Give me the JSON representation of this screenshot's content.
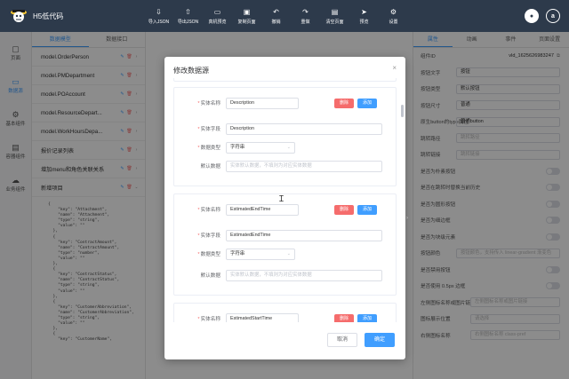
{
  "app": {
    "name": "H5低代码"
  },
  "toolbar": [
    {
      "icon": "⇩",
      "label": "导入JSON"
    },
    {
      "icon": "⇧",
      "label": "导出JSON"
    },
    {
      "icon": "▭",
      "label": "真机预览"
    },
    {
      "icon": "▣",
      "label": "复制页面"
    },
    {
      "icon": "↶",
      "label": "撤销"
    },
    {
      "icon": "↷",
      "label": "重做"
    },
    {
      "icon": "▤",
      "label": "清空页面"
    },
    {
      "icon": "➤",
      "label": "预览"
    },
    {
      "icon": "⚙",
      "label": "设置"
    }
  ],
  "rail": [
    {
      "icon": "▢",
      "label": "页面"
    },
    {
      "icon": "▭",
      "label": "数据源"
    },
    {
      "icon": "⚙",
      "label": "基本组件"
    },
    {
      "icon": "▤",
      "label": "容器组件"
    },
    {
      "icon": "☁",
      "label": "业务组件"
    }
  ],
  "left_panel": {
    "tabs": [
      "数据模型",
      "数据接口"
    ],
    "models": [
      "model.OrderPerson",
      "model.PMDepartment",
      "model.POAccount",
      "model.ResourceDepart...",
      "model.WorkHoursDepa...",
      "报价记录列表",
      "增加menu和角色关联关系",
      "新增项目"
    ],
    "code": "{\n    \"key\": \"Attachment\",\n    \"name\": \"Attachment\",\n    \"type\": \"string\",\n    \"value\": \"\"\n  },\n  {\n    \"key\": \"ContractAmount\",\n    \"name\": \"ContractAmount\",\n    \"type\": \"number\",\n    \"value\": \"\"\n  },\n  {\n    \"key\": \"ContractStatus\",\n    \"name\": \"ContractStatus\",\n    \"type\": \"string\",\n    \"value\": \"\"\n  },\n  {\n    \"key\": \"CustomerAbbreviation\",\n    \"name\": \"CustomerAbbreviation\",\n    \"type\": \"string\",\n    \"value\": \"\"\n  },\n  {\n    \"key\": \"CustomerName\","
  },
  "right_panel": {
    "tabs": [
      "属性",
      "动画",
      "事件",
      "页面设置"
    ],
    "component_id_label": "组件ID",
    "component_id": "vld_1625626983247",
    "rows": [
      {
        "label": "按钮文字",
        "value": "按钮"
      },
      {
        "label": "按钮类型",
        "value": "默认按钮"
      },
      {
        "label": "按钮尺寸",
        "value": "普通"
      },
      {
        "label": "原生button的type属性",
        "value": "普通button"
      },
      {
        "label": "跳转路径",
        "value": "跳转路径",
        "placeholder": true
      },
      {
        "label": "跳转链接",
        "value": "跳转链接",
        "placeholder": true
      }
    ],
    "toggles": [
      "是否为朴素按钮",
      "是否在跳转时替换当前历史",
      "是否为圆形按钮",
      "是否为细边框",
      "是否为块级元素"
    ],
    "color_row": {
      "label": "按钮颜色",
      "placeholder": "按钮颜色，支持传入 linear-gradient 渐变色"
    },
    "toggles2": [
      "是否禁用按钮",
      "是否使用 0.5px 边框"
    ],
    "extra_rows": [
      {
        "label": "左侧图标名称或图片链接",
        "placeholder": "左侧图标名称或图片链接"
      },
      {
        "label": "图标展示位置",
        "placeholder": "请选择"
      },
      {
        "label": "右侧图标名称",
        "placeholder": "右侧图标名称 class-pref"
      }
    ]
  },
  "dialog": {
    "title": "修改数据源",
    "close": "×",
    "labels": {
      "entity_name": "实体名称",
      "entity_field": "实体字段",
      "data_type": "数据类型",
      "default_data": "默认数据",
      "delete": "删除",
      "add": "添加"
    },
    "default_placeholder": "实体默认数据，不填则为对应实体数据",
    "entities": [
      {
        "name": "Description",
        "field": "Description",
        "type": "字符串"
      },
      {
        "name": "EstimatedEndTime",
        "field": "EstimatedEndTime",
        "type": "字符串"
      },
      {
        "name": "EstimatedStartTime"
      }
    ],
    "cancel": "取消",
    "confirm": "确定"
  }
}
